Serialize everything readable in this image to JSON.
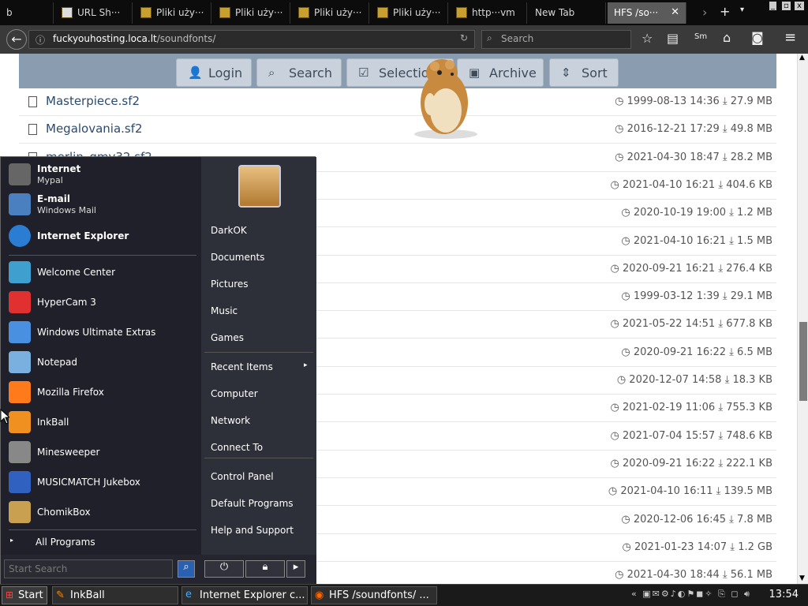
{
  "browser": {
    "tabs": [
      {
        "label": "b",
        "active": false
      },
      {
        "label": "URL Sh···",
        "active": false
      },
      {
        "label": "Pliki uży···",
        "active": false
      },
      {
        "label": "Pliki uży···",
        "active": false
      },
      {
        "label": "Pliki uży···",
        "active": false
      },
      {
        "label": "Pliki uży···",
        "active": false
      },
      {
        "label": "http···vm",
        "active": false
      },
      {
        "label": "New Tab",
        "active": false
      },
      {
        "label": "HFS /so···",
        "active": true
      }
    ],
    "url_host": "fuckyouhosting.loca.lt",
    "url_path": "/soundfonts/",
    "search_placeholder": "Search"
  },
  "hfs": {
    "buttons": [
      "Login",
      "Search",
      "Selection",
      "Archive",
      "Sort"
    ],
    "files": [
      {
        "name": "Masterpiece.sf2",
        "date": "1999-08-13 14:36",
        "size": "27.9 MB"
      },
      {
        "name": "Megalovania.sf2",
        "date": "2016-12-21 17:29",
        "size": "49.8 MB"
      },
      {
        "name": "merlin_gmv32.sf2",
        "date": "2021-04-30 18:47",
        "size": "28.2 MB"
      },
      {
        "name": "",
        "date": "2021-04-10 16:21",
        "size": "404.6 KB"
      },
      {
        "name": "",
        "date": "2020-10-19 19:00",
        "size": "1.2 MB"
      },
      {
        "name": "",
        "date": "2021-04-10 16:21",
        "size": "1.5 MB"
      },
      {
        "name": "",
        "date": "2020-09-21 16:21",
        "size": "276.4 KB"
      },
      {
        "name": "",
        "date": "1999-03-12 1:39",
        "size": "29.1 MB"
      },
      {
        "name": "",
        "date": "2021-05-22 14:51",
        "size": "677.8 KB"
      },
      {
        "name": "",
        "date": "2020-09-21 16:22",
        "size": "6.5 MB"
      },
      {
        "name": "",
        "date": "2020-12-07 14:58",
        "size": "18.3 KB"
      },
      {
        "name": "",
        "date": "2021-02-19 11:06",
        "size": "755.3 KB"
      },
      {
        "name": "",
        "date": "2021-07-04 15:57",
        "size": "748.6 KB"
      },
      {
        "name": "",
        "date": "2020-09-21 16:22",
        "size": "222.1 KB"
      },
      {
        "name": "",
        "date": "2021-04-10 16:11",
        "size": "139.5 MB"
      },
      {
        "name": "",
        "date": "2020-12-06 16:45",
        "size": "7.8 MB"
      },
      {
        "name": "",
        "date": "2021-01-23 14:07",
        "size": "1.2 GB"
      },
      {
        "name": "",
        "date": "2021-04-30 18:44",
        "size": "56.1 MB"
      }
    ]
  },
  "start_menu": {
    "pinned": [
      {
        "title": "Internet",
        "sub": "Mypal"
      },
      {
        "title": "E-mail",
        "sub": "Windows Mail"
      },
      {
        "title": "Internet Explorer",
        "sub": ""
      }
    ],
    "recent": [
      "Welcome Center",
      "HyperCam 3",
      "Windows Ultimate Extras",
      "Notepad",
      "Mozilla Firefox",
      "InkBall",
      "Minesweeper",
      "MUSICMATCH Jukebox",
      "ChomikBox"
    ],
    "all_programs": "All Programs",
    "right": [
      "DarkOK",
      "Documents",
      "Pictures",
      "Music",
      "Games",
      "Recent Items",
      "Computer",
      "Network",
      "Connect To",
      "Control Panel",
      "Default Programs",
      "Help and Support"
    ],
    "search_placeholder": "Start Search"
  },
  "taskbar": {
    "start": "Start",
    "tasks": [
      "InkBall",
      "Internet Explorer c...",
      "HFS /soundfonts/ ..."
    ],
    "clock": "13:54"
  }
}
